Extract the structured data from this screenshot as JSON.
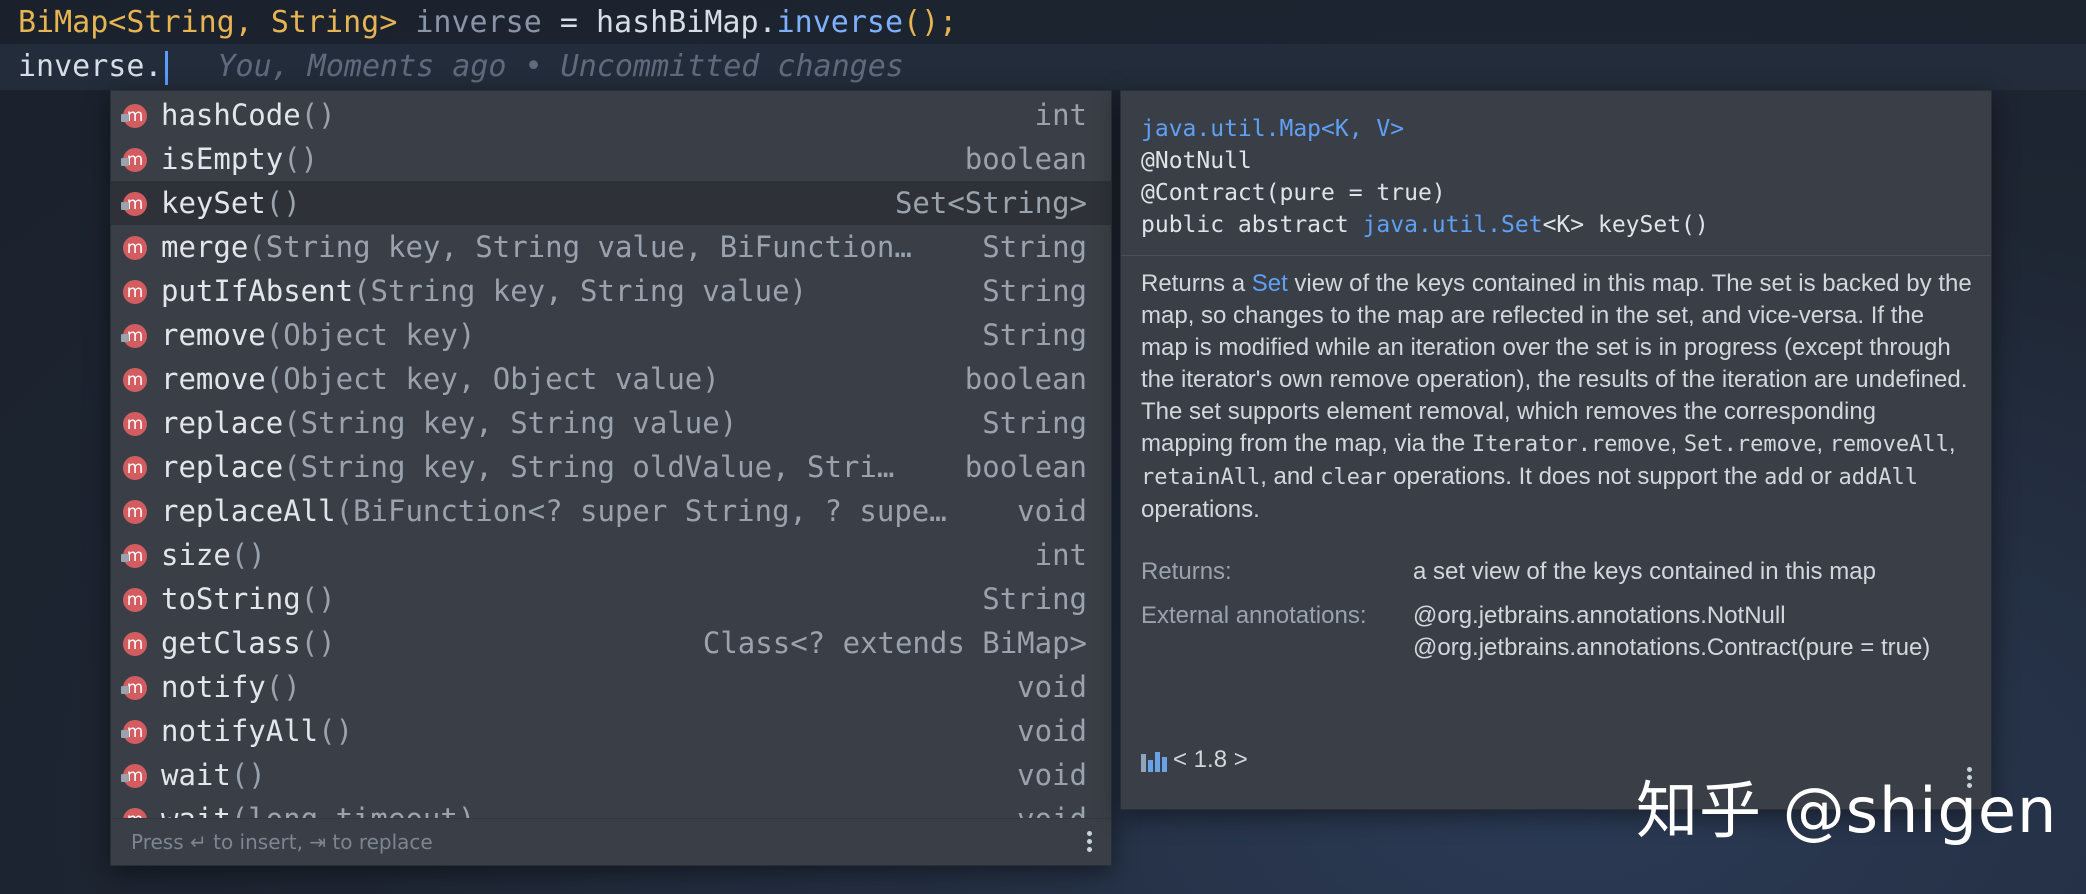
{
  "editor": {
    "line1": {
      "type": "BiMap<String, String>",
      "var_name": "inverse",
      "assign": " = hashBiMap.",
      "method": "inverse",
      "call": "();"
    },
    "line2": {
      "text": "inverse.",
      "inline_hint": "You, Moments ago • Uncommitted changes"
    }
  },
  "completion": {
    "items": [
      {
        "name": "hashCode",
        "params": "()",
        "return_type": "int",
        "icon": "method-icon-locked"
      },
      {
        "name": "isEmpty",
        "params": "()",
        "return_type": "boolean",
        "icon": "method-icon-locked"
      },
      {
        "name": "keySet",
        "params": "()",
        "return_type": "Set<String>",
        "icon": "method-icon-locked",
        "selected": true
      },
      {
        "name": "merge",
        "params": "(String key, String value, BiFunction…",
        "return_type": "String",
        "icon": "method-icon"
      },
      {
        "name": "putIfAbsent",
        "params": "(String key, String value)",
        "return_type": "String",
        "icon": "method-icon"
      },
      {
        "name": "remove",
        "params": "(Object key)",
        "return_type": "String",
        "icon": "method-icon-locked"
      },
      {
        "name": "remove",
        "params": "(Object key, Object value)",
        "return_type": "boolean",
        "icon": "method-icon"
      },
      {
        "name": "replace",
        "params": "(String key, String value)",
        "return_type": "String",
        "icon": "method-icon"
      },
      {
        "name": "replace",
        "params": "(String key, String oldValue, Stri…",
        "return_type": "boolean",
        "icon": "method-icon"
      },
      {
        "name": "replaceAll",
        "params": "(BiFunction<? super String, ? supe…",
        "return_type": "void",
        "icon": "method-icon"
      },
      {
        "name": "size",
        "params": "()",
        "return_type": "int",
        "icon": "method-icon-locked"
      },
      {
        "name": "toString",
        "params": "()",
        "return_type": "String",
        "icon": "method-icon"
      },
      {
        "name": "getClass",
        "params": "()",
        "return_type": "Class<? extends BiMap>",
        "icon": "method-icon"
      },
      {
        "name": "notify",
        "params": "()",
        "return_type": "void",
        "icon": "method-icon-locked"
      },
      {
        "name": "notifyAll",
        "params": "()",
        "return_type": "void",
        "icon": "method-icon-locked"
      },
      {
        "name": "wait",
        "params": "()",
        "return_type": "void",
        "icon": "method-icon-locked"
      },
      {
        "name": "wait",
        "params": "(long timeout)",
        "return_type": "void",
        "icon": "method-icon-locked"
      }
    ],
    "footer": "Press ↵ to insert, ⇥ to replace"
  },
  "doc": {
    "sig_class": "java.util.Map<K, V>",
    "ann1": "@NotNull",
    "ann2": "@Contract(pure = true)",
    "decl_pre": "public abstract ",
    "decl_link": "java.util.Set",
    "decl_post": "<K> keySet()",
    "body": {
      "p1": "Returns a ",
      "p1_link": "Set",
      "p2": " view of the keys contained in this map. The set is backed by the map, so changes to the map are reflected in the set, and vice-versa. If the map is modified while an iteration over the set is in progress (except through the iterator's own ",
      "p2_code": "remove",
      "p3": " operation), the results of the iteration are undefined. The set supports element removal, which removes the corresponding mapping from the map, via the ",
      "c1": "Iterator.remove",
      "s1": ", ",
      "c2": "Set.remove",
      "s2": ", ",
      "c3": "removeAll",
      "s3": ", ",
      "c4": "retainAll",
      "s4": ", and ",
      "c5": "clear",
      "s5": " operations. It does not support the ",
      "c6": "add",
      "s6": " or ",
      "c7": "addAll",
      "s7": " operations."
    },
    "returns_label": "Returns:",
    "returns_value": "a set view of the keys contained in this map",
    "ext_label": "External annotations:",
    "ext_value": "@org.jetbrains.annotations.NotNull @org.jetbrains.annotations.Contract(pure = true)",
    "library": "< 1.8 >"
  },
  "watermark": "知乎 @shigen"
}
